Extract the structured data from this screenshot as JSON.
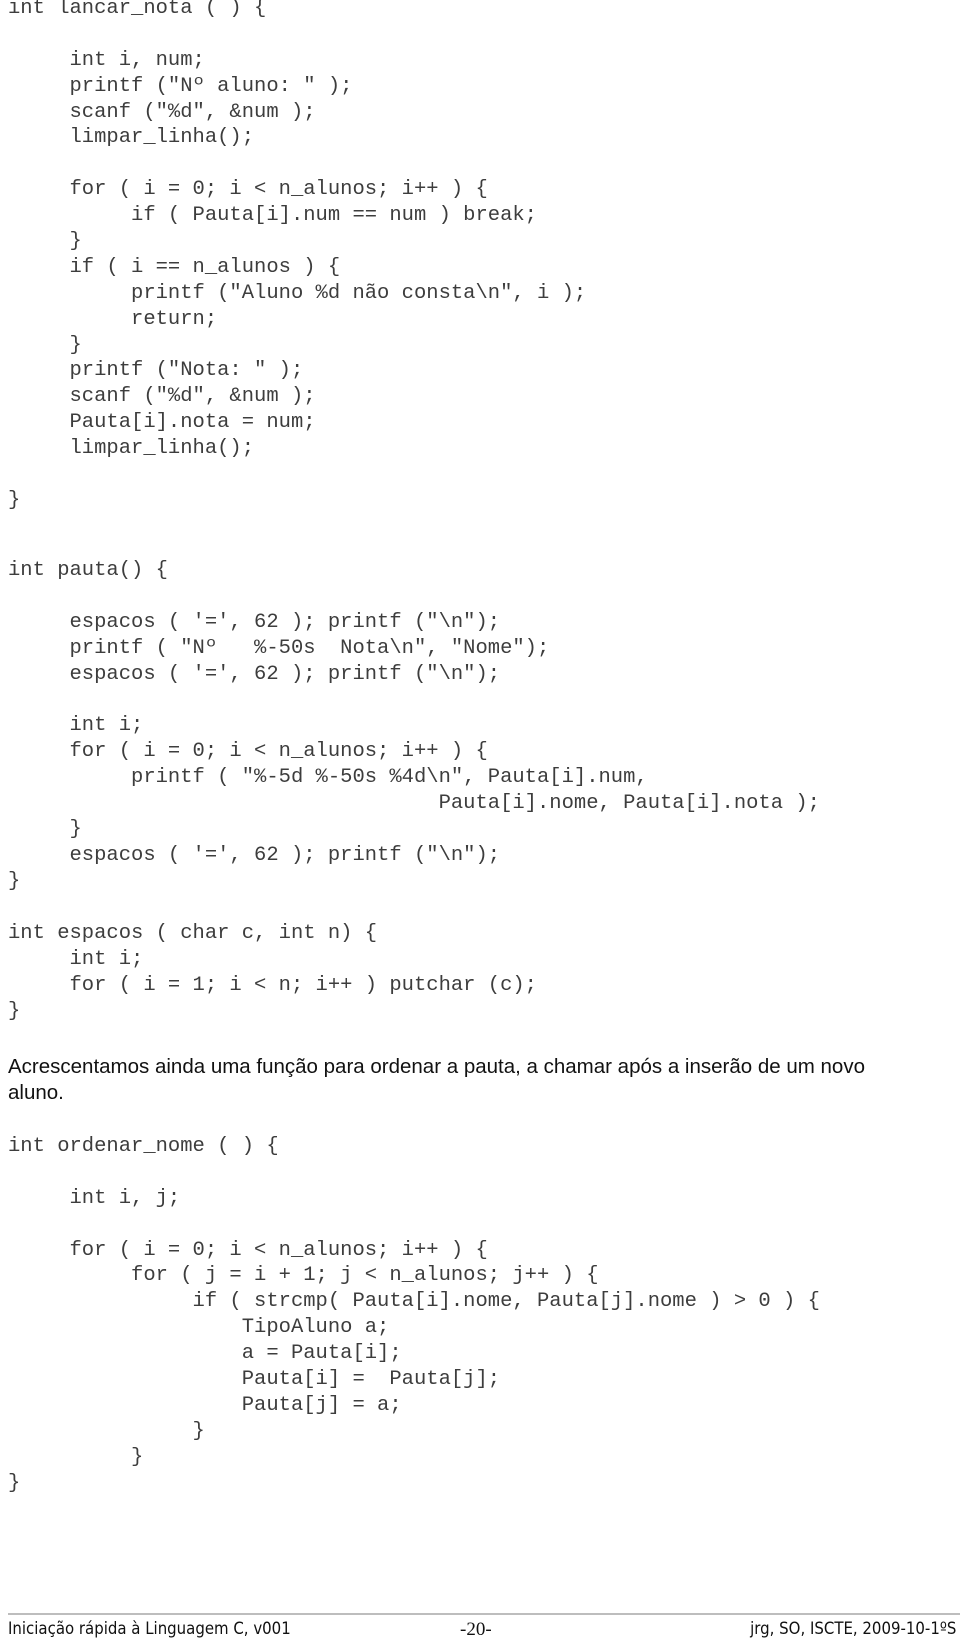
{
  "document": {
    "code_blocks": [
      {
        "name": "lancar-nota-function",
        "lines": [
          "int lancar_nota ( ) {",
          "",
          "     int i, num;",
          "     printf (\"Nº aluno: \" );",
          "     scanf (\"%d\", &num );",
          "     limpar_linha();",
          "",
          "     for ( i = 0; i < n_alunos; i++ ) {",
          "          if ( Pauta[i].num == num ) break;",
          "     }",
          "     if ( i == n_alunos ) {",
          "          printf (\"Aluno %d não consta\\n\", i );",
          "          return;",
          "     }",
          "     printf (\"Nota: \" );",
          "     scanf (\"%d\", &num );",
          "     Pauta[i].nota = num;",
          "     limpar_linha();",
          "",
          "}"
        ]
      },
      {
        "name": "pauta-function",
        "lines": [
          "int pauta() {",
          "",
          "     espacos ( '=', 62 ); printf (\"\\n\");",
          "     printf ( \"Nº   %-50s  Nota\\n\", \"Nome\");",
          "     espacos ( '=', 62 ); printf (\"\\n\");",
          "",
          "     int i;",
          "     for ( i = 0; i < n_alunos; i++ ) {",
          "          printf ( \"%-5d %-50s %4d\\n\", Pauta[i].num,",
          "                                   Pauta[i].nome, Pauta[i].nota );",
          "     }",
          "     espacos ( '=', 62 ); printf (\"\\n\");",
          "}"
        ]
      },
      {
        "name": "espacos-function",
        "lines": [
          "int espacos ( char c, int n) {",
          "     int i;",
          "     for ( i = 1; i < n; i++ ) putchar (c);",
          "}"
        ]
      },
      {
        "name": "ordenar-nome-function",
        "lines": [
          "int ordenar_nome ( ) {",
          "",
          "     int i, j;",
          "",
          "     for ( i = 0; i < n_alunos; i++ ) {",
          "          for ( j = i + 1; j < n_alunos; j++ ) {",
          "               if ( strcmp( Pauta[i].nome, Pauta[j].nome ) > 0 ) {",
          "                   TipoAluno a;",
          "                   a = Pauta[i];",
          "                   Pauta[i] =  Pauta[j];",
          "                   Pauta[j] = a;",
          "               }",
          "          }",
          "}"
        ]
      }
    ],
    "paragraph": "Acrescentamos ainda uma função para ordenar a pauta, a chamar após a inserão de um novo aluno."
  },
  "footer": {
    "left": "Iniciação rápida à Linguagem C, v001",
    "center": "-20-",
    "right": "jrg, SO, ISCTE, 2009-10-1ºS"
  }
}
